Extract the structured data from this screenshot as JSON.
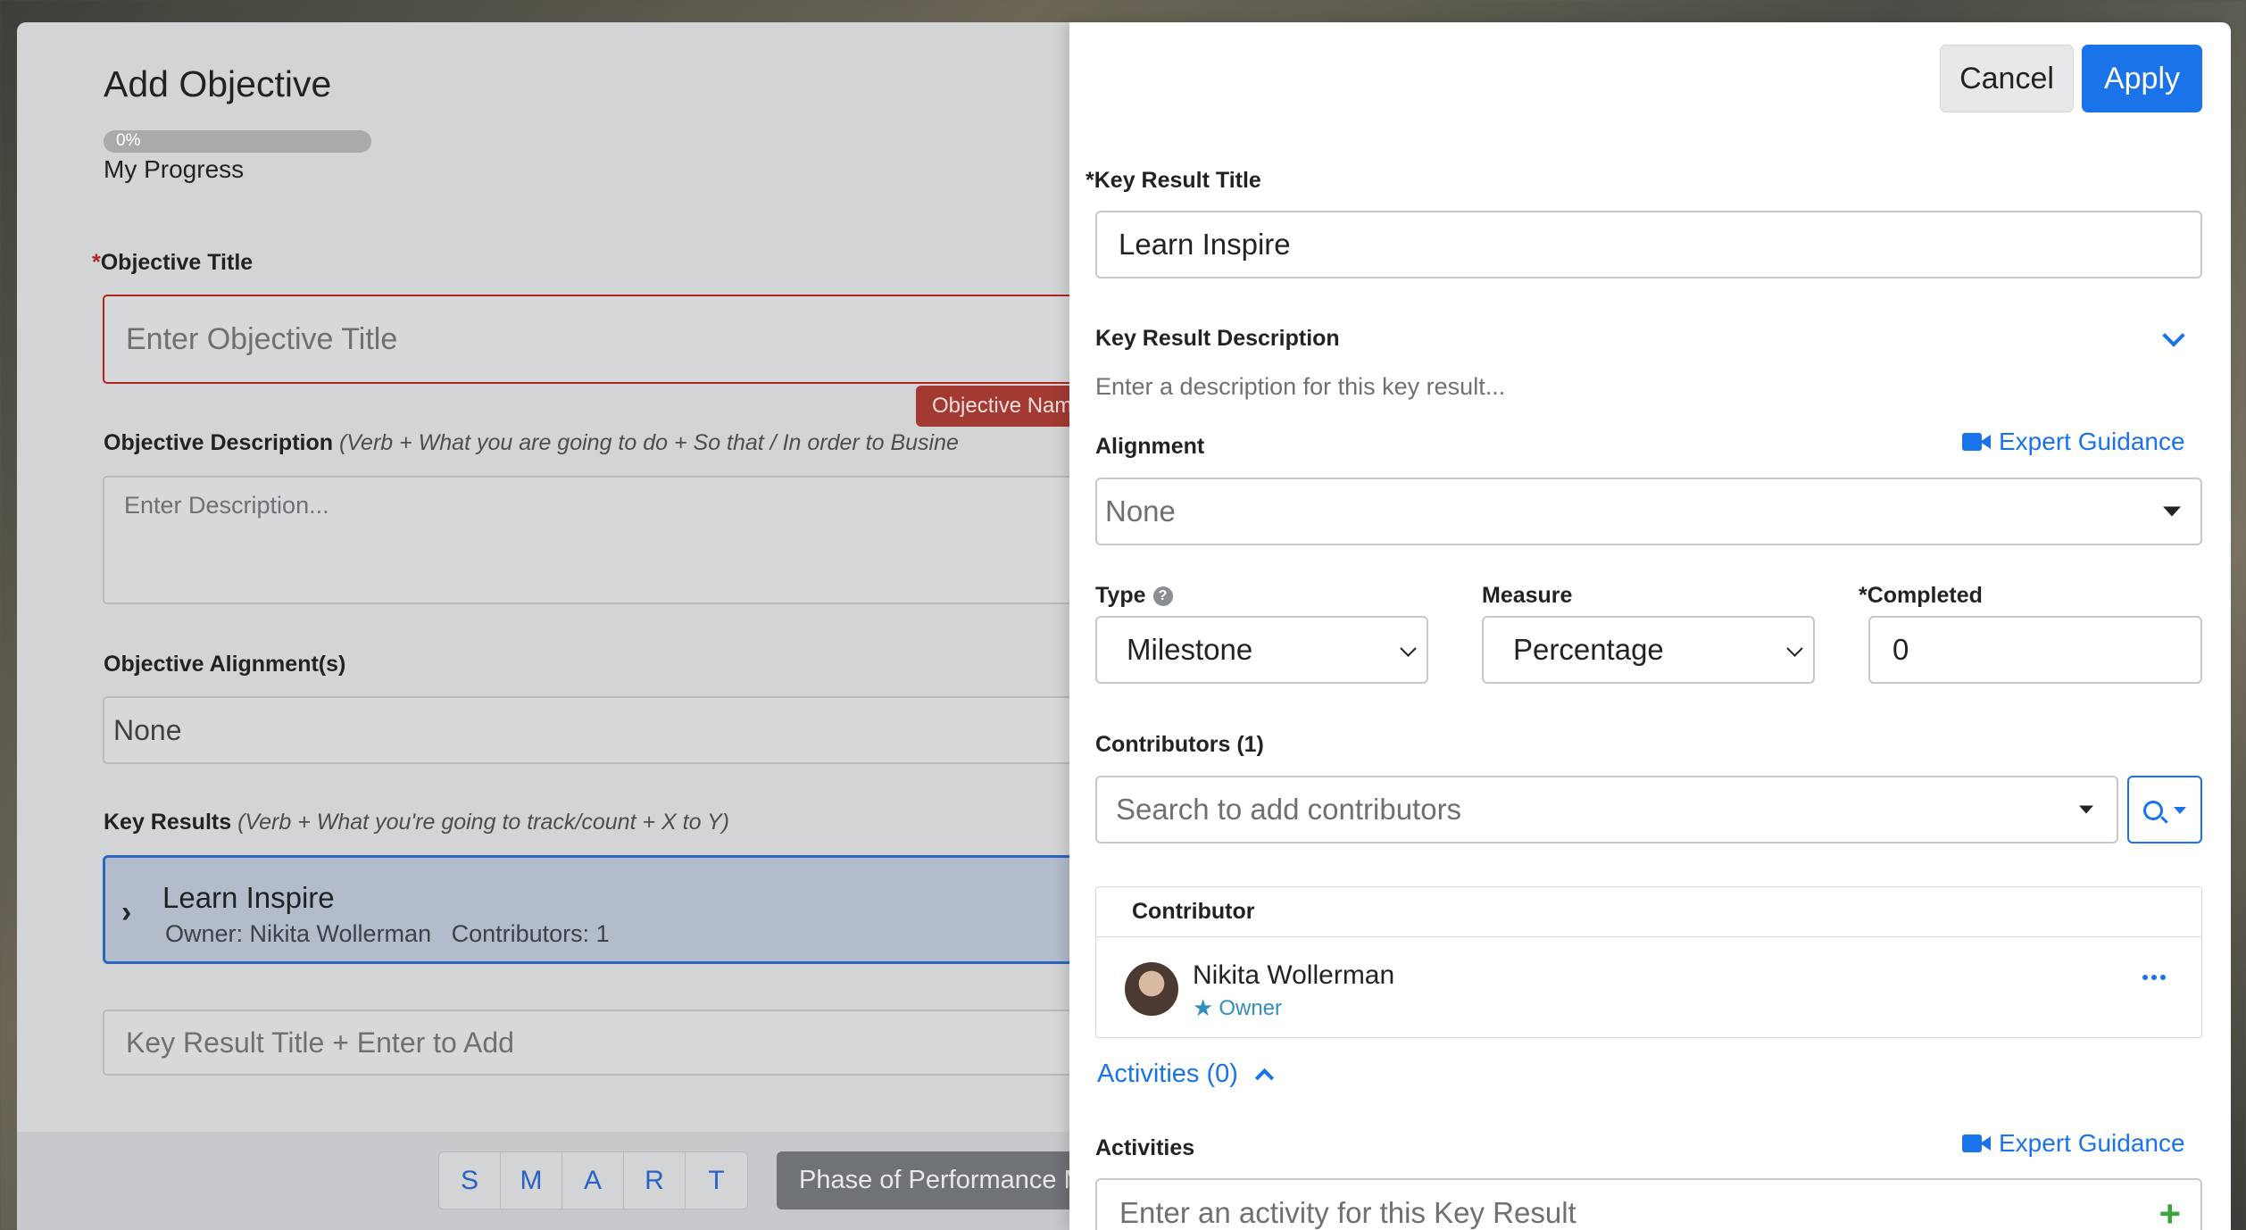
{
  "left_modal": {
    "title": "Add Objective",
    "progress": {
      "value_percent": 0,
      "label": "0%",
      "caption": "My Progress"
    },
    "objective_title": {
      "required_mark": "*",
      "label": "Objective Title",
      "placeholder": "Enter Objective Title",
      "error_tooltip": "Objective Name"
    },
    "objective_description": {
      "label": "Objective Description",
      "hint": "(Verb + What you are going to do + So that / In order to Busine",
      "placeholder": "Enter Description..."
    },
    "objective_alignment": {
      "label": "Objective Alignment(s)",
      "value": "None"
    },
    "key_results": {
      "label": "Key Results",
      "hint": "(Verb + What you're going to track/count + X to Y)",
      "items": [
        {
          "title": "Learn Inspire",
          "owner_text": "Owner: Nikita Wollerman",
          "contributors_text": "Contributors: 1"
        }
      ],
      "add_placeholder": "Key Result Title + Enter to Add"
    },
    "smart_letters": [
      "S",
      "M",
      "A",
      "R",
      "T"
    ],
    "phase_button": "Phase of Performance M"
  },
  "panel": {
    "cancel_label": "Cancel",
    "apply_label": "Apply",
    "kr_title": {
      "required_mark": "*",
      "label": "Key Result Title",
      "value": "Learn Inspire"
    },
    "kr_description": {
      "label": "Key Result Description",
      "placeholder": "Enter a description for this key result..."
    },
    "alignment": {
      "label": "Alignment",
      "value": "None",
      "guidance": "Expert Guidance"
    },
    "type": {
      "label": "Type",
      "value": "Milestone"
    },
    "measure": {
      "label": "Measure",
      "value": "Percentage"
    },
    "completed": {
      "label": "*Completed",
      "value": "0"
    },
    "contributors": {
      "label": "Contributors (1)",
      "search_placeholder": "Search to add contributors",
      "column_header": "Contributor",
      "rows": [
        {
          "name": "Nikita Wollerman",
          "role": "Owner"
        }
      ]
    },
    "activities_toggle": "Activities (0)",
    "activities": {
      "label": "Activities",
      "guidance": "Expert Guidance",
      "placeholder": "Enter an activity for this Key Result"
    }
  },
  "colors": {
    "accent": "#1a73e8",
    "error": "#b3261e",
    "add": "#3aa53a"
  }
}
